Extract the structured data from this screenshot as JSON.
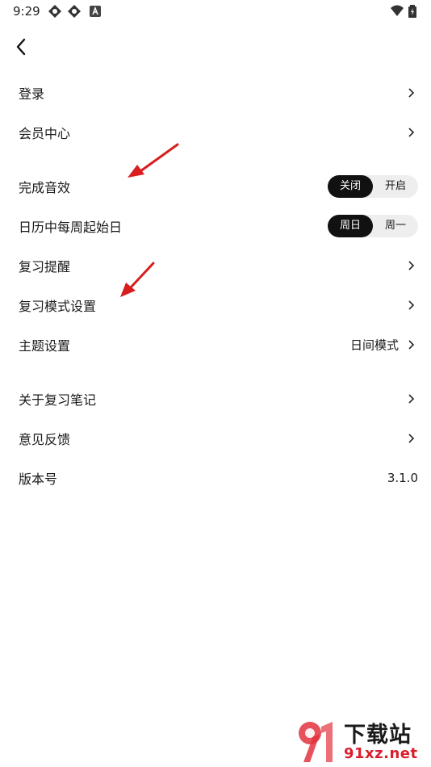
{
  "status_bar": {
    "time": "9:29"
  },
  "settings": {
    "login": {
      "label": "登录"
    },
    "member_center": {
      "label": "会员中心"
    },
    "completion_sound": {
      "label": "完成音效",
      "options": [
        "关闭",
        "开启"
      ],
      "selected": "关闭"
    },
    "week_start": {
      "label": "日历中每周起始日",
      "options": [
        "周日",
        "周一"
      ],
      "selected": "周日"
    },
    "review_reminder": {
      "label": "复习提醒"
    },
    "review_mode": {
      "label": "复习模式设置"
    },
    "theme": {
      "label": "主题设置",
      "value": "日间模式"
    },
    "about": {
      "label": "关于复习笔记"
    },
    "feedback": {
      "label": "意见反馈"
    },
    "version": {
      "label": "版本号",
      "value": "3.1.0"
    }
  },
  "watermark": {
    "title": "下载站",
    "url": "91xz.net"
  },
  "colors": {
    "accent": "#111111",
    "toggle_bg": "#eeeeee",
    "annotation_arrow": "#d81e1e",
    "watermark_red": "#d81e2c"
  }
}
